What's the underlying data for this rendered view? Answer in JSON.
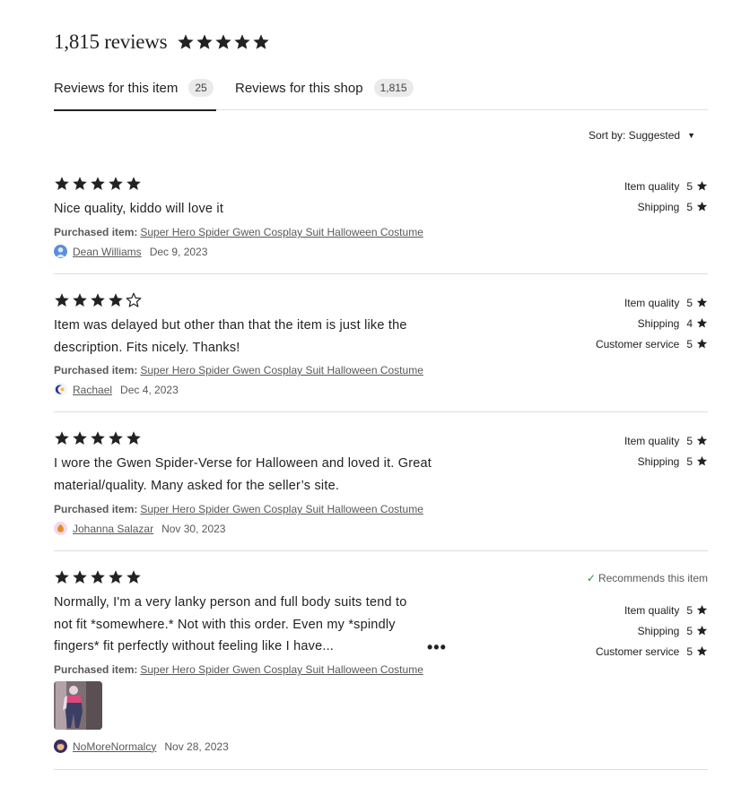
{
  "header": {
    "count": "1,815 reviews",
    "rating": 5
  },
  "tabs": [
    {
      "label": "Reviews for this item",
      "badge": "25",
      "active": true
    },
    {
      "label": "Reviews for this shop",
      "badge": "1,815",
      "active": false
    }
  ],
  "sort": {
    "label": "Sort by: Suggested"
  },
  "purchased_label": "Purchased item:",
  "reviews": [
    {
      "stars": 5,
      "text": "Nice quality, kiddo will love it",
      "item": "Super Hero Spider Gwen Cosplay Suit Halloween Costume",
      "author": "Dean Williams",
      "date": "Dec 9, 2023",
      "ratings": [
        {
          "label": "Item quality",
          "value": "5"
        },
        {
          "label": "Shipping",
          "value": "5"
        }
      ]
    },
    {
      "stars": 4,
      "text": "Item was delayed but other than that the item is just like the description. Fits nicely. Thanks!",
      "item": "Super Hero Spider Gwen Cosplay Suit Halloween Costume",
      "author": "Rachael",
      "date": "Dec 4, 2023",
      "ratings": [
        {
          "label": "Item quality",
          "value": "5"
        },
        {
          "label": "Shipping",
          "value": "4"
        },
        {
          "label": "Customer service",
          "value": "5"
        }
      ]
    },
    {
      "stars": 5,
      "text": "I wore the Gwen Spider-Verse for Halloween and loved it. Great material/quality. Many asked for the seller’s site.",
      "item": "Super Hero Spider Gwen Cosplay Suit Halloween Costume",
      "author": "Johanna Salazar",
      "date": "Nov 30, 2023",
      "ratings": [
        {
          "label": "Item quality",
          "value": "5"
        },
        {
          "label": "Shipping",
          "value": "5"
        }
      ]
    },
    {
      "stars": 5,
      "text": "Normally, I'm a very lanky person and full body suits tend to not fit *somewhere.* Not with this order. Even my *spindly fingers* fit perfectly without feeling like I have...",
      "more": "•••",
      "recommends": "Recommends this item",
      "item": "Super Hero Spider Gwen Cosplay Suit Halloween Costume",
      "author": "NoMoreNormalcy",
      "date": "Nov 28, 2023",
      "ratings": [
        {
          "label": "Item quality",
          "value": "5"
        },
        {
          "label": "Shipping",
          "value": "5"
        },
        {
          "label": "Customer service",
          "value": "5"
        }
      ]
    }
  ],
  "colors": {
    "text": "#222222",
    "muted": "#595959",
    "divider": "#dcdcdc",
    "badge_bg": "#eaeaea",
    "check": "#2f8a3e"
  }
}
